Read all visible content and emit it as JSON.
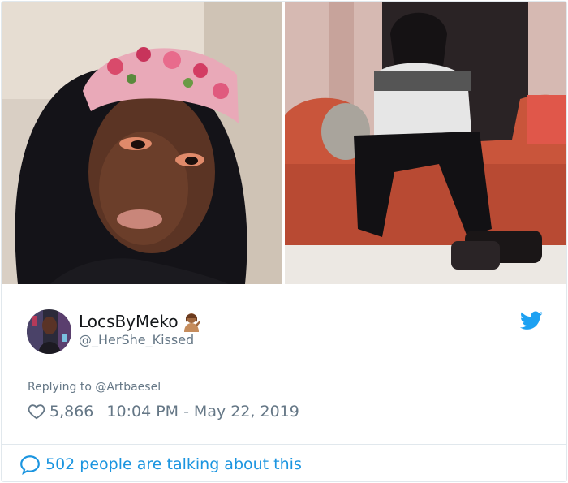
{
  "tweet": {
    "display_name": "LocsByMeko",
    "handle": "@_HerShe_Kissed",
    "replying_prefix": "Replying to ",
    "replying_to": "@Artbaesel",
    "likes": "5,866",
    "time": "10:04 PM",
    "separator": "-",
    "date": "May 22, 2019",
    "talking": "502 people are talking about this"
  },
  "icons": {
    "logo": "twitter-bird-icon",
    "like": "heart-icon",
    "talk": "speech-bubble-icon",
    "emoji": "person-tipping-hand-emoji"
  },
  "colors": {
    "accent": "#1da1f2",
    "link": "#1b95e0",
    "muted": "#657786",
    "text": "#14171a",
    "border": "#e1e8ed"
  }
}
